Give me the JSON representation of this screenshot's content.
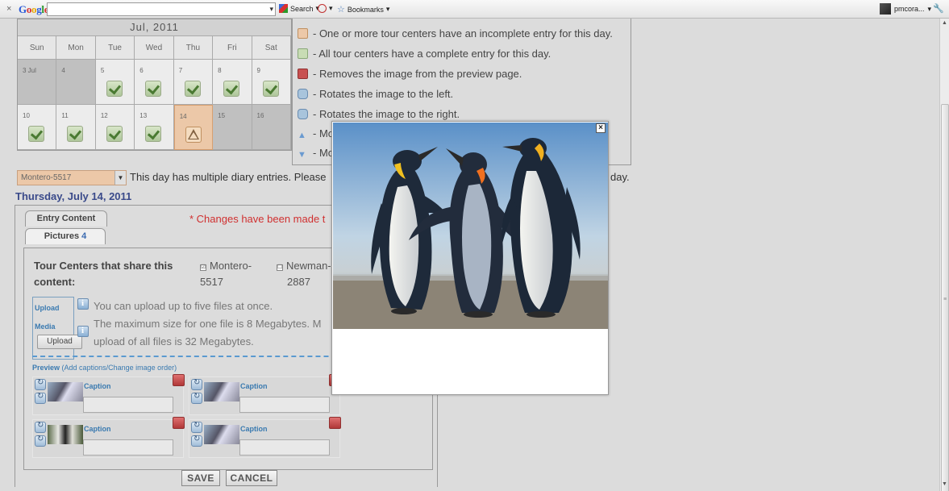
{
  "toolbar": {
    "close": "×",
    "logo": "Google",
    "search_dropdown": "▾",
    "search_label": "Search",
    "bookmarks_label": "Bookmarks",
    "user": "pmcora...",
    "menu_arrow": "▾",
    "wrench": "🔧"
  },
  "calendar": {
    "title": "Jul, 2011",
    "days": [
      "Sun",
      "Mon",
      "Tue",
      "Wed",
      "Thu",
      "Fri",
      "Sat"
    ],
    "week1": [
      "3 Jul",
      "4",
      "5",
      "6",
      "7",
      "8",
      "9"
    ],
    "week2": [
      "10",
      "11",
      "12",
      "13",
      "14",
      "15",
      "16"
    ]
  },
  "legend": {
    "items": [
      "- One or more tour centers have an incomplete entry for this day.",
      "- All tour centers have a complete entry for this day.",
      "- Removes the image from the preview page.",
      "- Rotates the image to the left.",
      "- Rotates the image to the right.",
      "- Mo",
      "- Mo"
    ]
  },
  "entry_select": {
    "value": "Montero-5517",
    "arrow": "▼"
  },
  "multi_message": "This day has multiple diary entries. Please",
  "multi_message_tail": "day.",
  "day_heading": "Thursday, July 14, 2011",
  "tabs": {
    "entry_content": "Entry Content",
    "pictures": "Pictures",
    "pictures_count": "4"
  },
  "changes_notice": "* Changes have been made t",
  "tour_centers": {
    "label": "Tour Centers that share this content:",
    "options": [
      {
        "name": "Montero-",
        "code": "5517",
        "checked": "☑"
      },
      {
        "name": "Newman-",
        "code": "2887",
        "checked": "☐"
      }
    ]
  },
  "upload": {
    "label_top": "Upload",
    "label_bottom": "Media",
    "button": "Upload",
    "line1": "You can upload up to five files at once.",
    "line2": "The maximum size for one file is 8 Megabytes. M",
    "line3": "upload of all files is 32 Megabytes."
  },
  "preview": {
    "label": "Preview",
    "hint": "(Add captions/Change image order)",
    "caption_label": "Caption"
  },
  "buttons": {
    "save": "SAVE",
    "cancel": "CANCEL"
  },
  "modal": {
    "close": "×"
  },
  "scrollbar": {
    "up": "▲",
    "down": "▼",
    "grip": "≡"
  }
}
